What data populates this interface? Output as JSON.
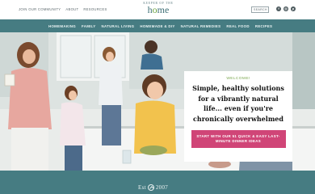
{
  "header": {
    "top_links": [
      "JOIN OUR COMMUNITY",
      "ABOUT",
      "RESOURCES"
    ],
    "logo_top": "KEEPER OF THE",
    "logo_word_a": "h",
    "logo_word_o": "o",
    "logo_word_b": "me",
    "search_label": "SEARCH",
    "social_icons": [
      "facebook-icon",
      "instagram-icon",
      "pinterest-icon"
    ]
  },
  "nav": {
    "items": [
      "HOMEMAKING",
      "FAMILY",
      "NATURAL LIVING",
      "HOMEMADE & DIY",
      "NATURAL REMEDIES",
      "REAL FOOD",
      "RECIPES"
    ]
  },
  "hero": {
    "welcome": "WELCOME!",
    "headline": "Simple, healthy solutions for a vibrantly natural life... even if you're chronically overwhelmed",
    "cta": "START WITH OUR 51 QUICK & EASY LAST-MINUTE DINNER IDEAS"
  },
  "footer": {
    "est_label": "Est",
    "est_year": "2007"
  },
  "colors": {
    "teal": "#467c82",
    "pink": "#d04577",
    "green": "#7aa64d"
  }
}
